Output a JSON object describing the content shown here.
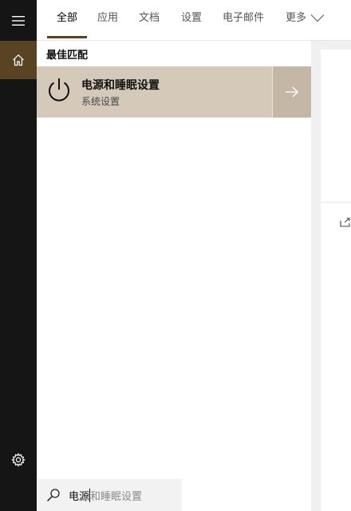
{
  "rail": {
    "menu_icon": "hamburger-menu-icon",
    "home_icon": "home-icon",
    "settings_icon": "gear-icon"
  },
  "tabs": [
    {
      "label": "全部",
      "active": true
    },
    {
      "label": "应用",
      "active": false
    },
    {
      "label": "文档",
      "active": false
    },
    {
      "label": "设置",
      "active": false
    },
    {
      "label": "电子邮件",
      "active": false
    },
    {
      "label": "更多",
      "active": false
    }
  ],
  "more_icon": "chevron-down-icon",
  "section_title": "最佳匹配",
  "best_match": {
    "icon": "power-icon",
    "title": "电源和睡眠设置",
    "subtitle": "系统设置",
    "arrow_icon": "arrow-right-icon"
  },
  "preview": {
    "open_icon": "open-icon"
  },
  "search": {
    "icon": "search-icon",
    "typed_text": "电源",
    "suggestion_text": "和睡眠设置"
  },
  "colors": {
    "accent": "#5a4323",
    "rail_bg": "#151515",
    "best_match_bg": "#d5c9ba",
    "arrow_btn_bg": "#c4b7a6"
  }
}
